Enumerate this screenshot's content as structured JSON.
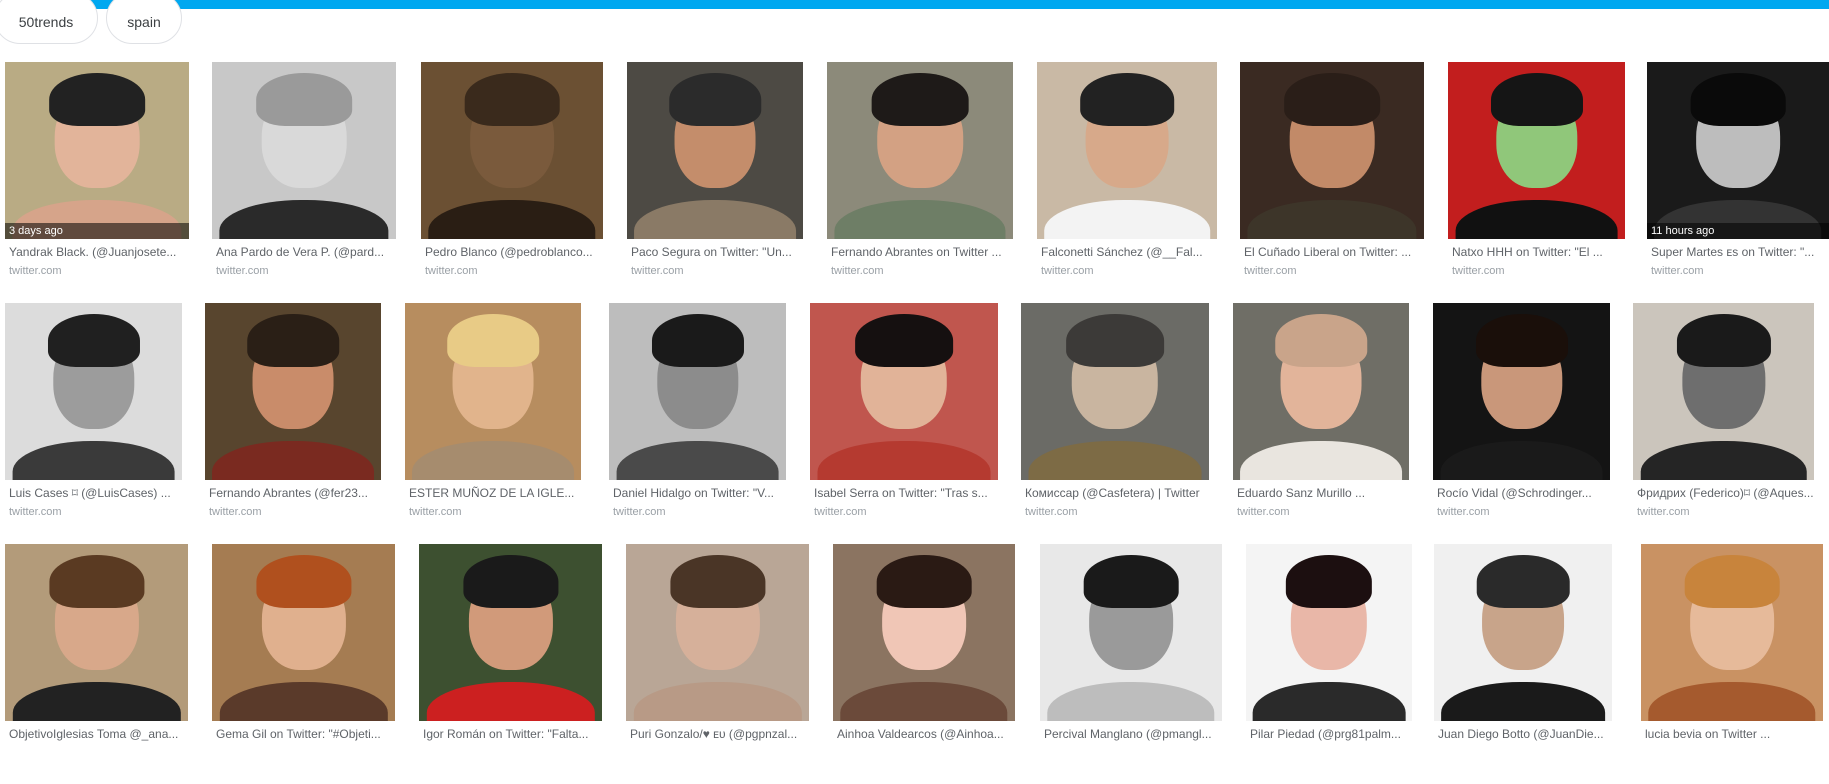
{
  "chips": [
    {
      "label": "50trends"
    },
    {
      "label": "spain"
    }
  ],
  "accent_color": "#00a8f0",
  "rows": [
    [
      {
        "title": "Yandrak Black. (@Juanjosete...",
        "source": "twitter.com",
        "stamp": "3 days ago"
      },
      {
        "title": "Ana Pardo de Vera P. (@pard...",
        "source": "twitter.com"
      },
      {
        "title": "Pedro Blanco (@pedroblanco...",
        "source": "twitter.com"
      },
      {
        "title": "Paco Segura on Twitter: \"Un...",
        "source": "twitter.com"
      },
      {
        "title": "Fernando Abrantes on Twitter ...",
        "source": "twitter.com"
      },
      {
        "title": "Falconetti Sánchez (@__Fal...",
        "source": "twitter.com"
      },
      {
        "title": "El Cuñado Liberal on Twitter: ...",
        "source": "twitter.com"
      },
      {
        "title": "Natxo HHH on Twitter: \"El ...",
        "source": "twitter.com"
      },
      {
        "title": "Super Martes ᴇs on Twitter: \"...",
        "source": "twitter.com",
        "stamp": "11 hours ago"
      }
    ],
    [
      {
        "title": "Luis Cases ⌑ (@LuisCases) ...",
        "source": "twitter.com"
      },
      {
        "title": "Fernando Abrantes (@fer23...",
        "source": "twitter.com"
      },
      {
        "title": "ESTER MUÑOZ DE LA IGLE...",
        "source": "twitter.com"
      },
      {
        "title": "Daniel Hidalgo on Twitter: \"V...",
        "source": "twitter.com"
      },
      {
        "title": "Isabel Serra on Twitter: \"Tras s...",
        "source": "twitter.com"
      },
      {
        "title": "Комиссар (@Casfetera) | Twitter",
        "source": "twitter.com"
      },
      {
        "title": "Eduardo Sanz Murillo ...",
        "source": "twitter.com"
      },
      {
        "title": "Rocío Vidal (@Schrodinger...",
        "source": "twitter.com"
      },
      {
        "title": "Фридрих (Federico)⌑ (@Aques...",
        "source": "twitter.com"
      }
    ],
    [
      {
        "title": "ObjetivoIglesias Toma @_ana...",
        "source": ""
      },
      {
        "title": "Gema Gil on Twitter: \"#Objeti...",
        "source": ""
      },
      {
        "title": "Igor Román on Twitter: \"Falta...",
        "source": ""
      },
      {
        "title": "Puri Gonzalo/♥ ᴇᴜ (@pgpnzal...",
        "source": ""
      },
      {
        "title": "Ainhoa Valdearcos (@Ainhoa...",
        "source": ""
      },
      {
        "title": "Percival Manglano (@pmangl...",
        "source": ""
      },
      {
        "title": "Pilar Piedad (@prg81palm...",
        "source": ""
      },
      {
        "title": "Juan Diego Botto (@JuanDie...",
        "source": ""
      },
      {
        "title": "lucia bevia on Twitter ...",
        "source": ""
      }
    ]
  ]
}
